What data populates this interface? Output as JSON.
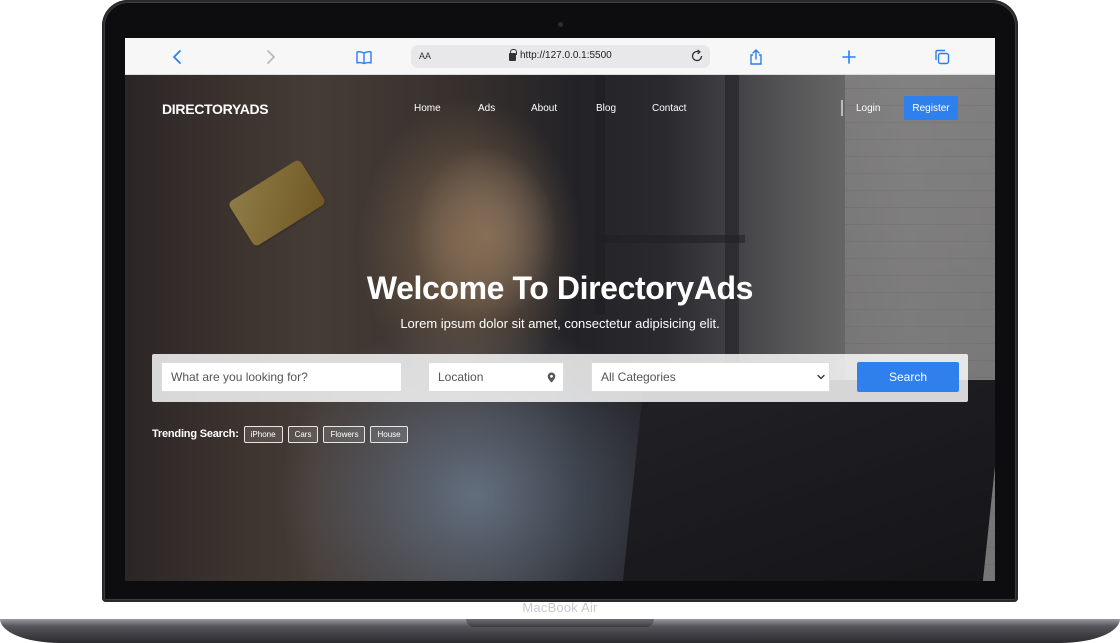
{
  "device": {
    "label": "MacBook Air"
  },
  "browser": {
    "text_size_label": "AA",
    "url": "http://127.0.0.1:5500",
    "icons": [
      "back-icon",
      "forward-icon",
      "bookmarks-icon",
      "lock-icon",
      "reload-icon",
      "share-icon",
      "new-tab-icon",
      "tabs-icon"
    ]
  },
  "site": {
    "brand": "DIRECTORYADS",
    "nav": [
      {
        "label": "Home"
      },
      {
        "label": "Ads"
      },
      {
        "label": "About"
      },
      {
        "label": "Blog"
      },
      {
        "label": "Contact"
      }
    ],
    "login_label": "Login",
    "register_label": "Register",
    "colors": {
      "accent": "#2f80ed",
      "text_on_hero": "#ffffff"
    }
  },
  "hero": {
    "title": "Welcome To DirectoryAds",
    "subtitle": "Lorem ipsum dolor sit amet, consectetur adipisicing elit."
  },
  "search": {
    "query_placeholder": "What are you looking for?",
    "location_placeholder": "Location",
    "category_selected": "All Categories",
    "button_label": "Search"
  },
  "trending": {
    "label": "Trending Search:",
    "tags": [
      "iPhone",
      "Cars",
      "Flowers",
      "House"
    ]
  }
}
